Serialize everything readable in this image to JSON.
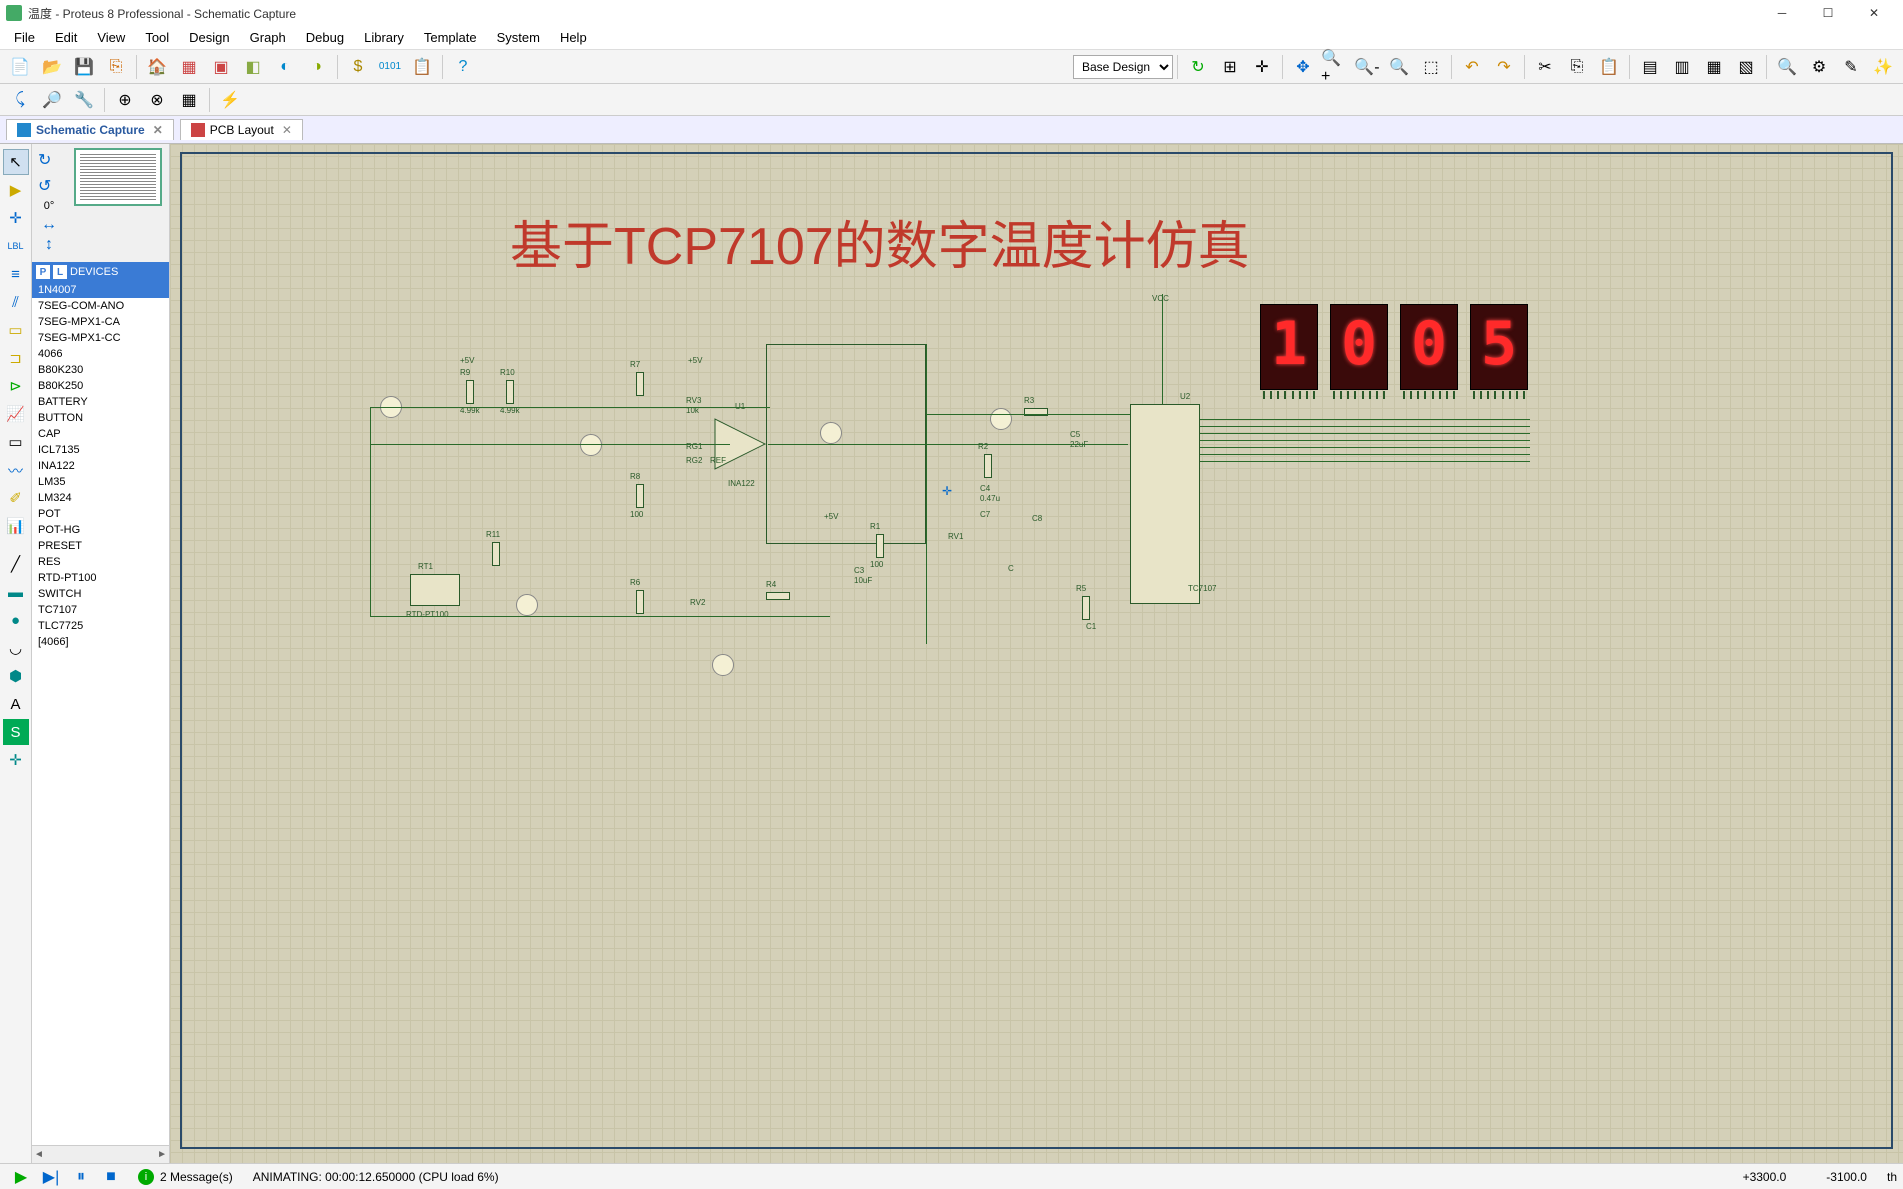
{
  "window": {
    "title": "温度 - Proteus 8 Professional - Schematic Capture"
  },
  "menu": {
    "items": [
      "File",
      "Edit",
      "View",
      "Tool",
      "Design",
      "Graph",
      "Debug",
      "Library",
      "Template",
      "System",
      "Help"
    ]
  },
  "toolbar1": {
    "design_selector": "Base Design"
  },
  "tabs": {
    "t1": {
      "label": "Schematic Capture"
    },
    "t2": {
      "label": "PCB Layout"
    }
  },
  "sidepanel": {
    "rotation": "0°",
    "devices_header": "DEVICES",
    "p_label": "P",
    "l_label": "L",
    "items": [
      "1N4007",
      "7SEG-COM-ANO",
      "7SEG-MPX1-CA",
      "7SEG-MPX1-CC",
      "4066",
      "B80K230",
      "B80K250",
      "BATTERY",
      "BUTTON",
      "CAP",
      "ICL7135",
      "INA122",
      "LM35",
      "LM324",
      "POT",
      "POT-HG",
      "PRESET",
      "RES",
      "RTD-PT100",
      "SWITCH",
      "TC7107",
      "TLC7725",
      "[4066]"
    ]
  },
  "canvas": {
    "title_text": "基于TCP7107的数字温度计仿真",
    "display_digits": [
      "1",
      "0",
      "0",
      "5"
    ],
    "chip_u1": "U1",
    "chip_u2": "U2",
    "chip_u2_part": "TC7107",
    "chip_u1_part": "INA122",
    "rtd": "RT1",
    "rtd_part": "RTD-PT100",
    "vcc": "VCC",
    "plus5v": "+5V",
    "components": {
      "R1": "100",
      "R3": "",
      "R4": "",
      "R5": "",
      "R6": "",
      "R8": "100",
      "R9": "4.99k",
      "R10": "4.99k",
      "R11": "",
      "RV1": "",
      "RV2": "",
      "RV3": "10k",
      "C1": "",
      "C3": "10uF",
      "C4": "0.47u",
      "C5": "22uF",
      "C7": "",
      "C8": "",
      "RG1": "",
      "RG2": "",
      "REF": ""
    }
  },
  "status": {
    "messages": "2 Message(s)",
    "animating": "ANIMATING: 00:00:12.650000 (CPU load 6%)",
    "coord_x": "+3300.0",
    "coord_y": "-3100.0",
    "unit": "th"
  }
}
